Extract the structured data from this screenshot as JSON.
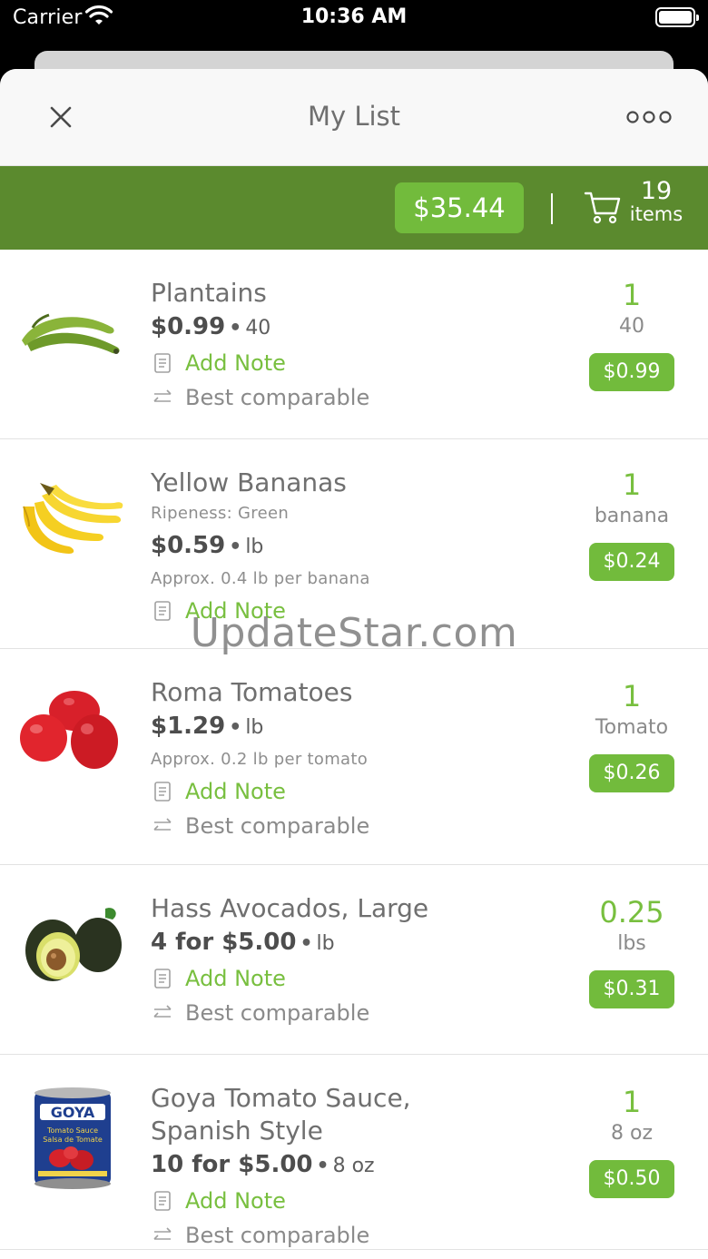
{
  "status_bar": {
    "carrier": "Carrier",
    "time": "10:36 AM"
  },
  "nav": {
    "title": "My List"
  },
  "summary": {
    "total": "$35.44",
    "count": "19",
    "count_label": "items"
  },
  "items": [
    {
      "name": "Plantains",
      "price": "$0.99",
      "unit": "40",
      "note": "Add Note",
      "comparable": "Best comparable",
      "qty": "1",
      "qty_unit": "40",
      "line_total": "$0.99"
    },
    {
      "name": "Yellow Bananas",
      "ripeness": "Ripeness: Green",
      "price": "$0.59",
      "unit": "lb",
      "approx": "Approx. 0.4 lb per banana",
      "note": "Add Note",
      "qty": "1",
      "qty_unit": "banana",
      "line_total": "$0.24"
    },
    {
      "name": "Roma Tomatoes",
      "price": "$1.29",
      "unit": "lb",
      "approx": "Approx. 0.2 lb per tomato",
      "note": "Add Note",
      "comparable": "Best comparable",
      "qty": "1",
      "qty_unit": "Tomato",
      "line_total": "$0.26"
    },
    {
      "name": "Hass Avocados, Large",
      "price": "4 for $5.00",
      "unit": "lb",
      "note": "Add Note",
      "comparable": "Best comparable",
      "qty": "0.25",
      "qty_unit": "lbs",
      "line_total": "$0.31"
    },
    {
      "name_line1": "Goya Tomato Sauce,",
      "name_line2": "Spanish Style",
      "price": "10 for $5.00",
      "unit": "8 oz",
      "note": "Add Note",
      "comparable": "Best comparable",
      "qty": "1",
      "qty_unit": "8 oz",
      "line_total": "$0.50",
      "can_brand": "GOYA",
      "can_label_1": "Tomato Sauce",
      "can_label_2": "Salsa de Tomate"
    }
  ],
  "watermark": "UpdateStar.com",
  "colors": {
    "brand_green": "#5b8a2e",
    "accent_green": "#72bb3c",
    "text_green": "#78bf3f"
  }
}
